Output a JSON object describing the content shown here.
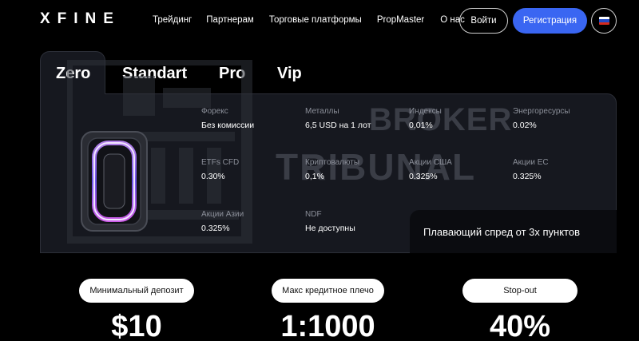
{
  "header": {
    "logo": "XFINE",
    "nav": [
      "Трейдинг",
      "Партнерам",
      "Торговые платформы",
      "PropMaster",
      "О нас"
    ],
    "login_label": "Войти",
    "register_label": "Регистрация",
    "language_icon": "russian-flag-icon"
  },
  "tabs": [
    {
      "label": "Zero",
      "active": true
    },
    {
      "label": "Standart",
      "active": false
    },
    {
      "label": "Pro",
      "active": false
    },
    {
      "label": "Vip",
      "active": false
    }
  ],
  "stats": [
    {
      "label": "Форекс",
      "value": "Без комиссии"
    },
    {
      "label": "Металлы",
      "value": "6,5 USD на 1 лот"
    },
    {
      "label": "Индексы",
      "value": "0,01%"
    },
    {
      "label": "Энергоресурсы",
      "value": "0.02%"
    },
    {
      "label": "ETFs CFD",
      "value": "0.30%"
    },
    {
      "label": "Криптовалюты",
      "value": "0,1%"
    },
    {
      "label": "Акции США",
      "value": "0.325%"
    },
    {
      "label": "Акции ЕС",
      "value": "0.325%"
    },
    {
      "label": "Акции Азии",
      "value": "0.325%"
    },
    {
      "label": "NDF",
      "value": "Не доступны"
    }
  ],
  "spread_text": "Плавающий спред от 3х пунктов",
  "watermark": {
    "line1": "BROKER",
    "line2": "TRIBUNAL"
  },
  "metrics": [
    {
      "label": "Минимальный депозит",
      "value": "$10"
    },
    {
      "label": "Макс кредитное плечо",
      "value": "1:1000"
    },
    {
      "label": "Stop-out",
      "value": "40%"
    }
  ],
  "colors": {
    "accent": "#3a66f2",
    "panel": "#16181f",
    "background": "#000000"
  }
}
